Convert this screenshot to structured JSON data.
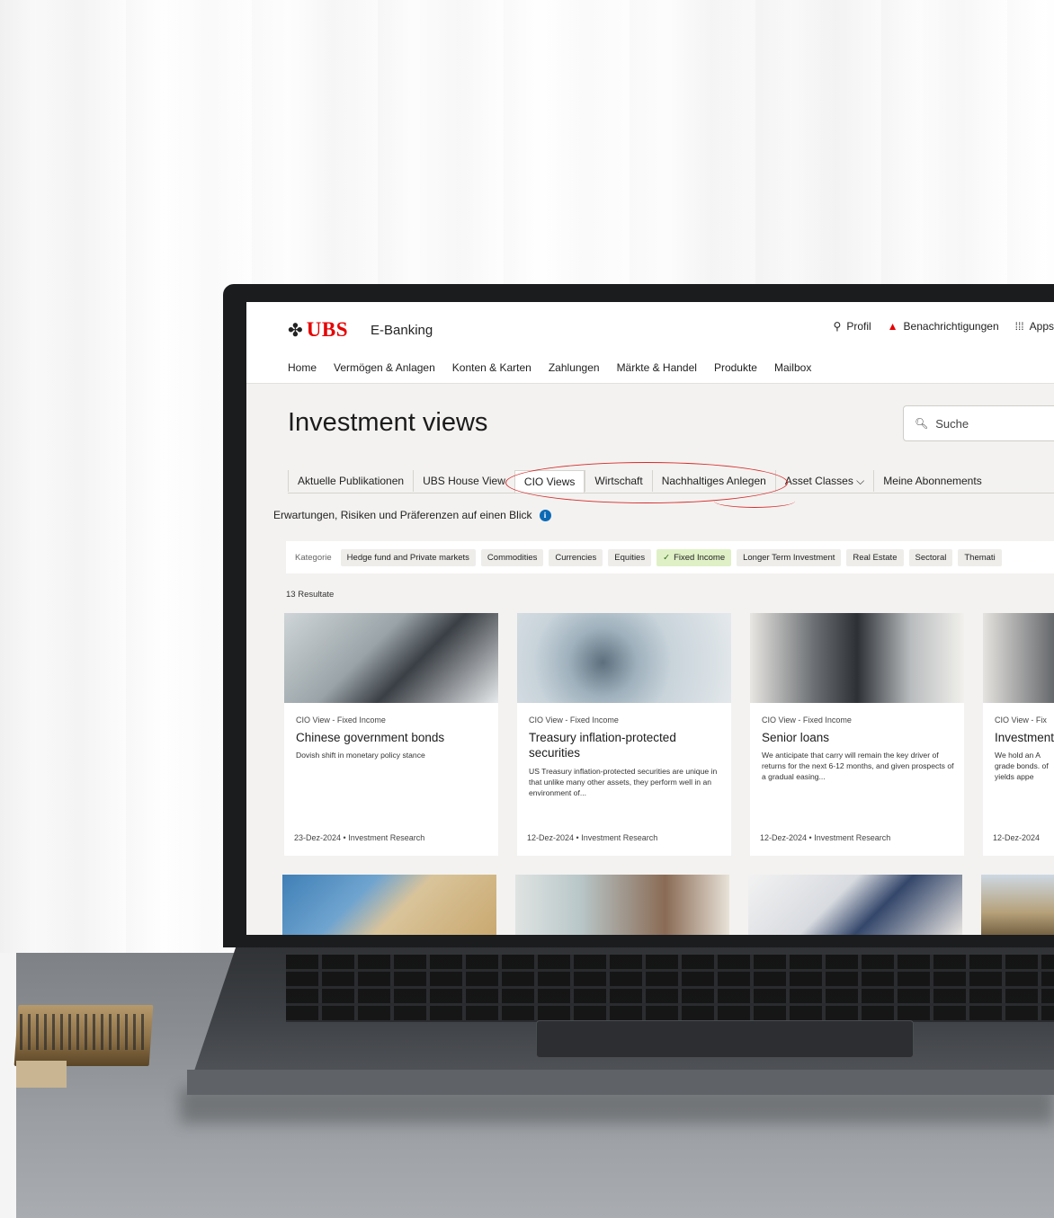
{
  "header": {
    "brand": "UBS",
    "product": "E-Banking",
    "links": [
      {
        "label": "Profil",
        "icon": "user-icon"
      },
      {
        "label": "Benachrichtigungen",
        "icon": "bell-icon"
      },
      {
        "label": "Apps",
        "icon": "grid-icon"
      }
    ]
  },
  "main_nav": [
    "Home",
    "Vermögen & Anlagen",
    "Konten & Karten",
    "Zahlungen",
    "Märkte & Handel",
    "Produkte",
    "Mailbox"
  ],
  "page": {
    "title": "Investment views",
    "search_placeholder": "Suche",
    "subtitle": "Erwartungen, Risiken und Präferenzen auf einen Blick",
    "results": "13 Resultate"
  },
  "tabs": [
    {
      "label": "Aktuelle Publikationen"
    },
    {
      "label": "UBS House View"
    },
    {
      "label": "CIO Views"
    },
    {
      "label": "Wirtschaft"
    },
    {
      "label": "Nachhaltiges Anlegen"
    },
    {
      "label": "Asset Classes ⌵"
    },
    {
      "label": "Meine Abonnements"
    }
  ],
  "filter": {
    "label": "Kategorie",
    "chips": [
      "Hedge fund and Private markets",
      "Commodities",
      "Currencies",
      "Equities",
      "Fixed Income",
      "Longer Term Investment",
      "Real Estate",
      "Sectoral",
      "Themati"
    ],
    "selected": "Fixed Income"
  },
  "cards": [
    {
      "kicker": "CIO View - Fixed Income",
      "title": "Chinese government bonds",
      "desc": "Dovish shift in monetary policy stance",
      "date": "23-Dez-2024",
      "author": "Investment Research"
    },
    {
      "kicker": "CIO View - Fixed Income",
      "title": "Treasury inflation-protected securities",
      "desc": "US Treasury inflation-protected securities are unique in that unlike many other assets, they perform well in an environment of...",
      "date": "12-Dez-2024",
      "author": "Investment Research"
    },
    {
      "kicker": "CIO View - Fixed Income",
      "title": "Senior loans",
      "desc": "We anticipate that carry will remain the key driver of returns for the next 6-12 months, and given prospects of a gradual easing...",
      "date": "12-Dez-2024",
      "author": "Investment Research"
    },
    {
      "kicker": "CIO View - Fix",
      "title": "Investment",
      "desc": "We hold an A grade bonds. of yields appe",
      "date": "12-Dez-2024",
      "author": ""
    }
  ],
  "colors": {
    "brand_red": "#e60000",
    "highlight_oval": "#d42b2b",
    "selected_chip": "#dff0c6",
    "info_blue": "#0c6ab5"
  }
}
